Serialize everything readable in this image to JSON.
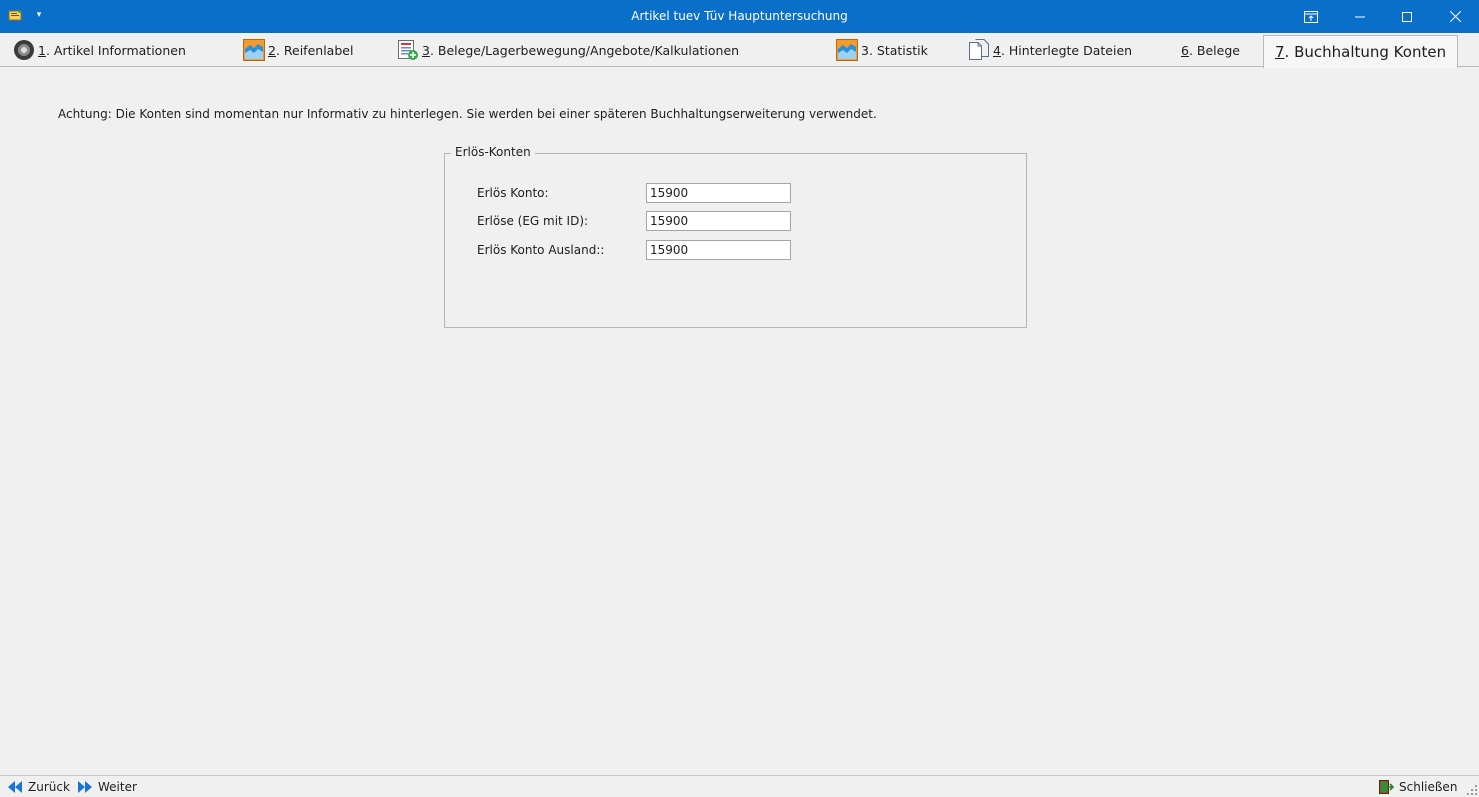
{
  "window": {
    "title": "Artikel tuev Tüv Hauptuntersuchung",
    "quick_access_glyph": "▾",
    "controls": [
      "restore-ribbon-icon",
      "minimize-icon",
      "maximize-icon",
      "close-icon"
    ]
  },
  "tabs": [
    {
      "num": "1",
      "label": ". Artikel Informationen",
      "icon": "tire-icon"
    },
    {
      "num": "2",
      "label": ". Reifenlabel",
      "icon": "chart-icon"
    },
    {
      "num": "3",
      "label": ". Belege/Lagerbewegung/Angebote/Kalkulationen",
      "icon": "document-add-icon"
    },
    {
      "num": "",
      "label": "3. Statistik",
      "icon": "chart-icon"
    },
    {
      "num": "4",
      "label": ". Hinterlegte Dateien",
      "icon": "files-icon"
    },
    {
      "num": "6",
      "label": ". Belege",
      "icon": ""
    },
    {
      "num": "7",
      "label": ". Buchhaltung Konten",
      "icon": "",
      "active": true
    }
  ],
  "notice": "Achtung: Die Konten sind momentan nur Informativ zu hinterlegen. Sie werden bei einer späteren Buchhaltungserweiterung verwendet.",
  "group": {
    "legend": "Erlös-Konten",
    "fields": [
      {
        "label": "Erlös Konto:",
        "value": "15900"
      },
      {
        "label": "Erlöse (EG mit ID):",
        "value": "15900"
      },
      {
        "label": "Erlös Konto Ausland::",
        "value": "15900"
      }
    ]
  },
  "statusbar": {
    "back_label": "Zurück",
    "forward_label": "Weiter",
    "close_label": "Schließen"
  },
  "colors": {
    "titlebar": "#0a6fc9",
    "nav_arrow": "#1a73d6",
    "background": "#f0f0f0"
  }
}
